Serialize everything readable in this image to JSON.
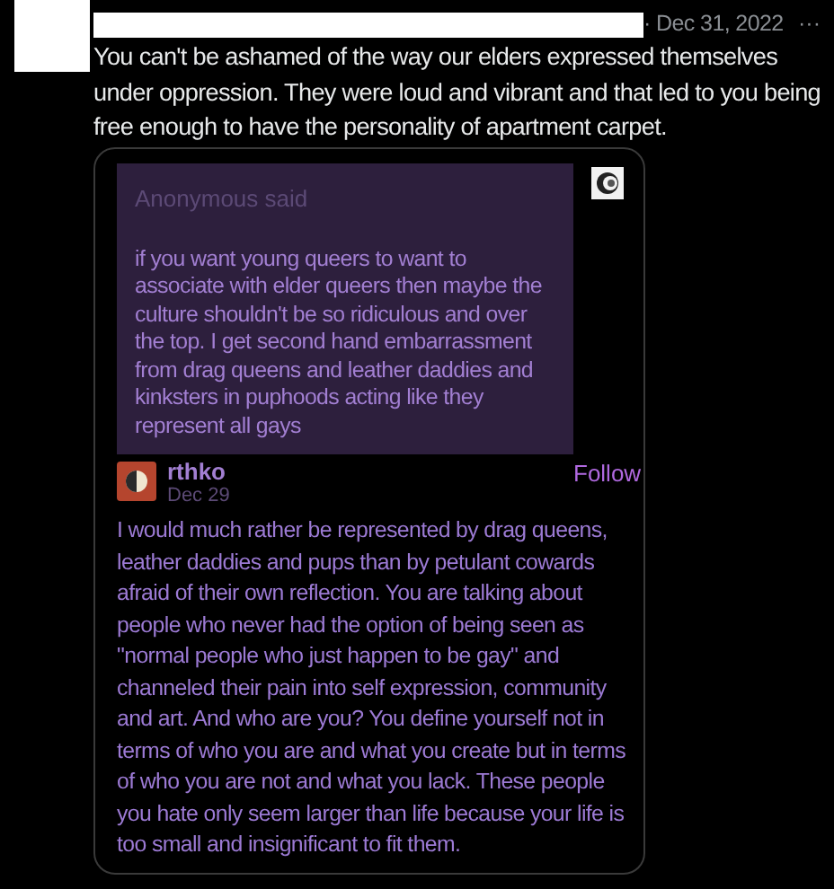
{
  "tweet": {
    "date": "· Dec 31, 2022",
    "more": "···",
    "text": "You can't be ashamed of the way our elders expressed themselves under oppression. They were loud and vibrant and that led to you being free enough to have the personality of apartment carpet."
  },
  "embed": {
    "ask": {
      "asker": "Anonymous said",
      "question": "if you want young queers to want to associate with elder queers then maybe the culture shouldn't be so ridiculous and over the top. I get second hand embarrassment from drag queens and leather daddies and kinksters in puphoods acting like they represent all gays"
    },
    "answer": {
      "author": "rthko",
      "date": "Dec 29",
      "follow": "Follow",
      "text": "I would much rather be represented by drag queens, leather daddies and pups than by petulant cowards afraid of their own reflection. You are talking about people who never had the option of being seen as \"normal people who just happen to be gay\" and channeled their pain into self expression, community and art. And who are you? You define yourself not in terms of who you are and what you create but in terms of who you are not and what you lack. These people you hate only seem larger than life because your life is too small and insignificant to fit them."
    }
  }
}
